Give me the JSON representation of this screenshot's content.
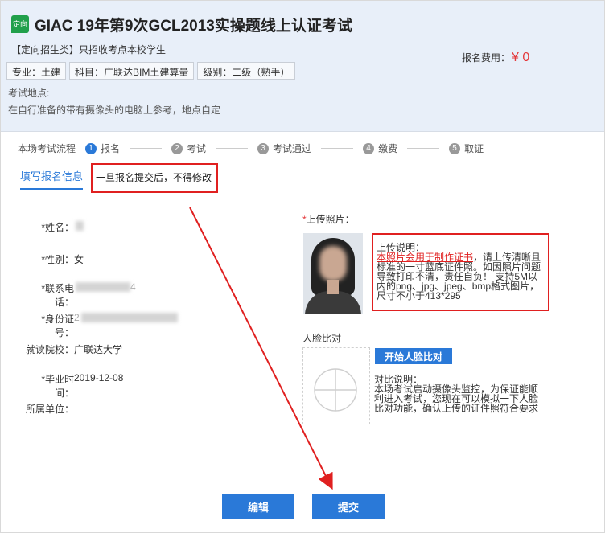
{
  "header": {
    "badge": "定向",
    "title": "GIAC 19年第9次GCL2013实操题线上认证考试",
    "subtitle": "【定向招生类】只招收考点本校学生",
    "chips": [
      "专业：土建",
      "科目：广联达BIM土建算量",
      "级别：二级（熟手）"
    ],
    "location_label": "考试地点:",
    "location_value": "在自行准备的带有摄像头的电脑上参考，地点自定",
    "fee_label": "报名费用：",
    "fee_amount": "¥ 0"
  },
  "steps": {
    "label": "本场考试流程",
    "items": [
      {
        "num": "1",
        "label": "报名"
      },
      {
        "num": "2",
        "label": "考试"
      },
      {
        "num": "3",
        "label": "考试通过"
      },
      {
        "num": "4",
        "label": "缴费"
      },
      {
        "num": "5",
        "label": "取证"
      }
    ]
  },
  "tab": {
    "label": "填写报名信息",
    "note": "一旦报名提交后，不得修改"
  },
  "form": {
    "name_label": "*姓名：",
    "gender_label": "*性别：",
    "gender_value": "女",
    "phone_label": "*联系电话：",
    "phone_tail": "4",
    "id_label": "*身份证号：",
    "id_head": "2",
    "school_label": "就读院校：",
    "school_value": "广联达大学",
    "grad_label": "*毕业时间：",
    "grad_value": "2019-12-08",
    "org_label": "所属单位："
  },
  "upload": {
    "label_star": "*",
    "label": "上传照片：",
    "desc_title": "上传说明：",
    "desc_red": "本照片会用于制作证书",
    "desc_rest": "，请上传清晰且标准的一寸蓝底证件照。如因照片问题导致打印不清，责任自负！ 支持5M以内的png、jpg、jpeg、bmp格式图片，尺寸不小于413*295"
  },
  "face": {
    "label": "人脸比对",
    "button": "开始人脸比对",
    "desc_title": "对比说明：",
    "desc": "本场考试启动摄像头监控，为保证能顺利进入考试，您现在可以模拟一下人脸比对功能，确认上传的证件照符合要求"
  },
  "buttons": {
    "edit": "编辑",
    "submit": "提交"
  }
}
